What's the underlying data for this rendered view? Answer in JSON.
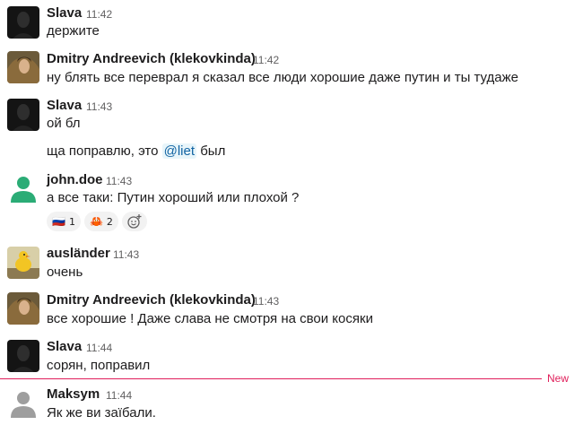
{
  "colors": {
    "mention": "#1264a3",
    "new_divider": "#e01e5a",
    "timestamp": "#616061"
  },
  "messages": [
    {
      "author": "Slava",
      "time": "11:42",
      "text": "держите",
      "avatar": "dark-portrait"
    },
    {
      "author": "Dmitry Andreevich (klekovkinda)",
      "time": "11:42",
      "text": "ну блять все переврал я сказал все люди хорошие даже путин и ты тудаже",
      "avatar": "portrait"
    },
    {
      "author": "Slava",
      "time": "11:43",
      "text": "ой бл",
      "text2_prefix": "ща поправлю, это ",
      "text2_mention": "@liet",
      "text2_suffix": " был",
      "avatar": "dark-portrait"
    },
    {
      "author": "john.doe",
      "time": "11:43",
      "text": "а все таки: Путин хороший или плохой ?",
      "avatar": "default-user",
      "reactions": [
        {
          "emoji": "🇷🇺",
          "icon": "flag-russia-icon",
          "count": "1"
        },
        {
          "emoji": "🦀",
          "icon": "crab-icon",
          "count": "2"
        }
      ]
    },
    {
      "author": "ausländer",
      "time": "11:43",
      "text": "очень",
      "avatar": "duck"
    },
    {
      "author": "Dmitry Andreevich (klekovkinda)",
      "time": "11:43",
      "text": "все хорошие ! Даже слава не смотря на свои косяки",
      "avatar": "portrait"
    },
    {
      "author": "Slava",
      "time": "11:44",
      "text": "сорян, поправил",
      "avatar": "dark-portrait"
    },
    {
      "author": "Maksym",
      "time": "11:44",
      "text": "Як же ви заїбали.",
      "avatar": "default-user"
    }
  ],
  "new_label": "New"
}
